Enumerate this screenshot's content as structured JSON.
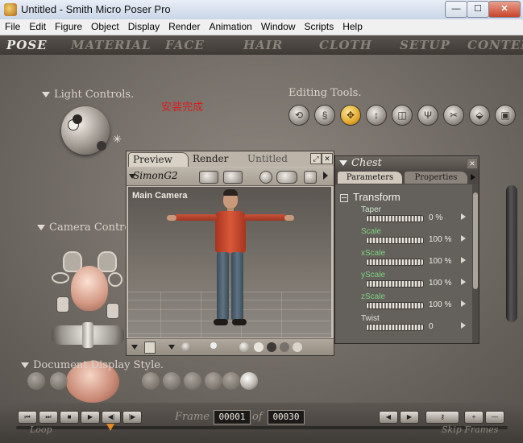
{
  "window": {
    "title": "Untitled - Smith Micro Poser Pro",
    "min_glyph": "—",
    "max_glyph": "☐",
    "close_glyph": "✕"
  },
  "menu": [
    "File",
    "Edit",
    "Figure",
    "Object",
    "Display",
    "Render",
    "Animation",
    "Window",
    "Scripts",
    "Help"
  ],
  "rooms": [
    "POSE",
    "MATERIAL",
    "FACE",
    "HAIR",
    "CLOTH",
    "SETUP",
    "CONTEN"
  ],
  "active_room": "POSE",
  "panels": {
    "light_controls": "Light Controls.",
    "editing_tools": "Editing Tools.",
    "camera_controls": "Camera Controls.",
    "document_display_style": "Document Display Style."
  },
  "overlay_text": "安装完成",
  "preview": {
    "tabs": [
      "Preview",
      "Render",
      "Untitled"
    ],
    "figure_name": "SimonG2",
    "camera_label": "Main Camera"
  },
  "properties": {
    "actor_name": "Chest",
    "tabs": [
      "Parameters",
      "Properties"
    ],
    "group": "Transform",
    "params": [
      {
        "name": "Taper",
        "value": "0 %",
        "color": "#c9e6c9"
      },
      {
        "name": "Scale",
        "value": "100 %",
        "color": "#7fd27f"
      },
      {
        "name": "xScale",
        "value": "100 %",
        "color": "#7fd27f"
      },
      {
        "name": "yScale",
        "value": "100 %",
        "color": "#7fd27f"
      },
      {
        "name": "zScale",
        "value": "100 %",
        "color": "#7fd27f"
      },
      {
        "name": "Twist",
        "value": "0",
        "color": "#e6e1d9"
      }
    ]
  },
  "animation": {
    "frame_label": "Frame",
    "current_frame": "00001",
    "of_label": "of",
    "total_frames": "00030",
    "loop_label": "Loop",
    "skip_label": "Skip Frames",
    "transport_left": [
      "⏮",
      "⏭",
      "■",
      "▶",
      "◀|",
      "|▶"
    ],
    "transport_right": [
      "◀",
      "▶",
      "⚷",
      "+",
      "—"
    ]
  },
  "colors": {
    "accent_active_tool": "#e3a72a",
    "overlay_red": "#d52020"
  }
}
